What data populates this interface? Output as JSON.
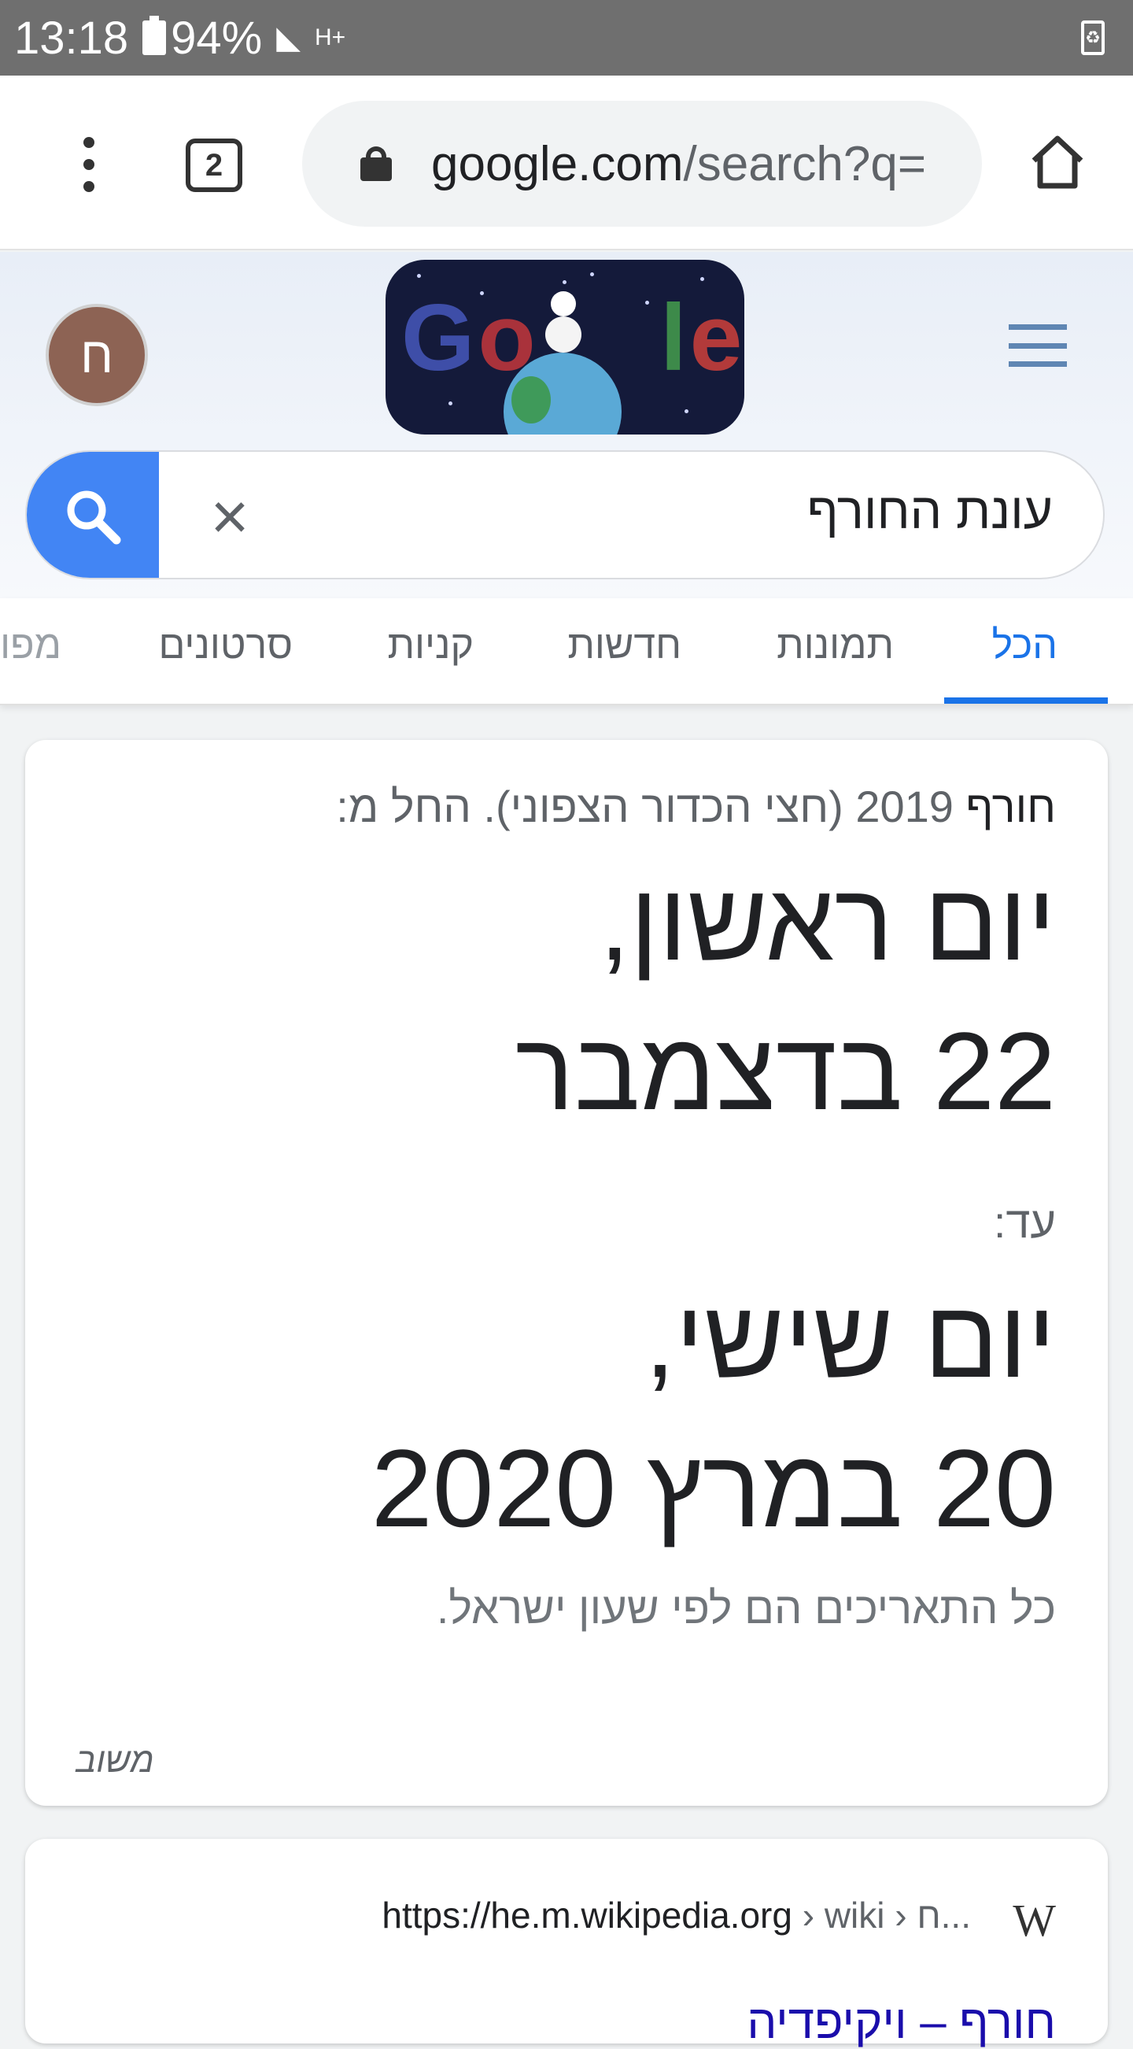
{
  "status_bar": {
    "time": "13:18",
    "battery": "94%",
    "network": "H+"
  },
  "browser": {
    "tab_count": "2",
    "url_host": "google.com",
    "url_path": "/search?q="
  },
  "google": {
    "avatar_letter": "ח",
    "doodle_text": "Google",
    "search_query": "עונת החורף"
  },
  "tabs": [
    {
      "label": "הכל",
      "active": true
    },
    {
      "label": "תמונות"
    },
    {
      "label": "חדשות"
    },
    {
      "label": "קניות"
    },
    {
      "label": "סרטונים"
    },
    {
      "label": "מפו"
    }
  ],
  "answer_card": {
    "season": "חורף",
    "year_hemisphere": "2019 (חצי הכדור הצפוני). החל מ:",
    "start_weekday": "יום ראשון,",
    "start_date": "22 בדצמבר",
    "until_label": "עד:",
    "end_weekday": "יום שישי,",
    "end_date": "20 במרץ 2020",
    "timezone_note": "כל התאריכים הם לפי שעון ישראל.",
    "feedback": "משוב"
  },
  "result": {
    "logo": "W",
    "url": "https://he.m.wikipedia.org",
    "breadcrumbs": "› wiki › ח...",
    "title": "חורף – ויקיפדיה"
  },
  "colors": {
    "accent": "#1a73e8",
    "search_button": "#4285f4",
    "status_bar": "#6f6f6f"
  }
}
